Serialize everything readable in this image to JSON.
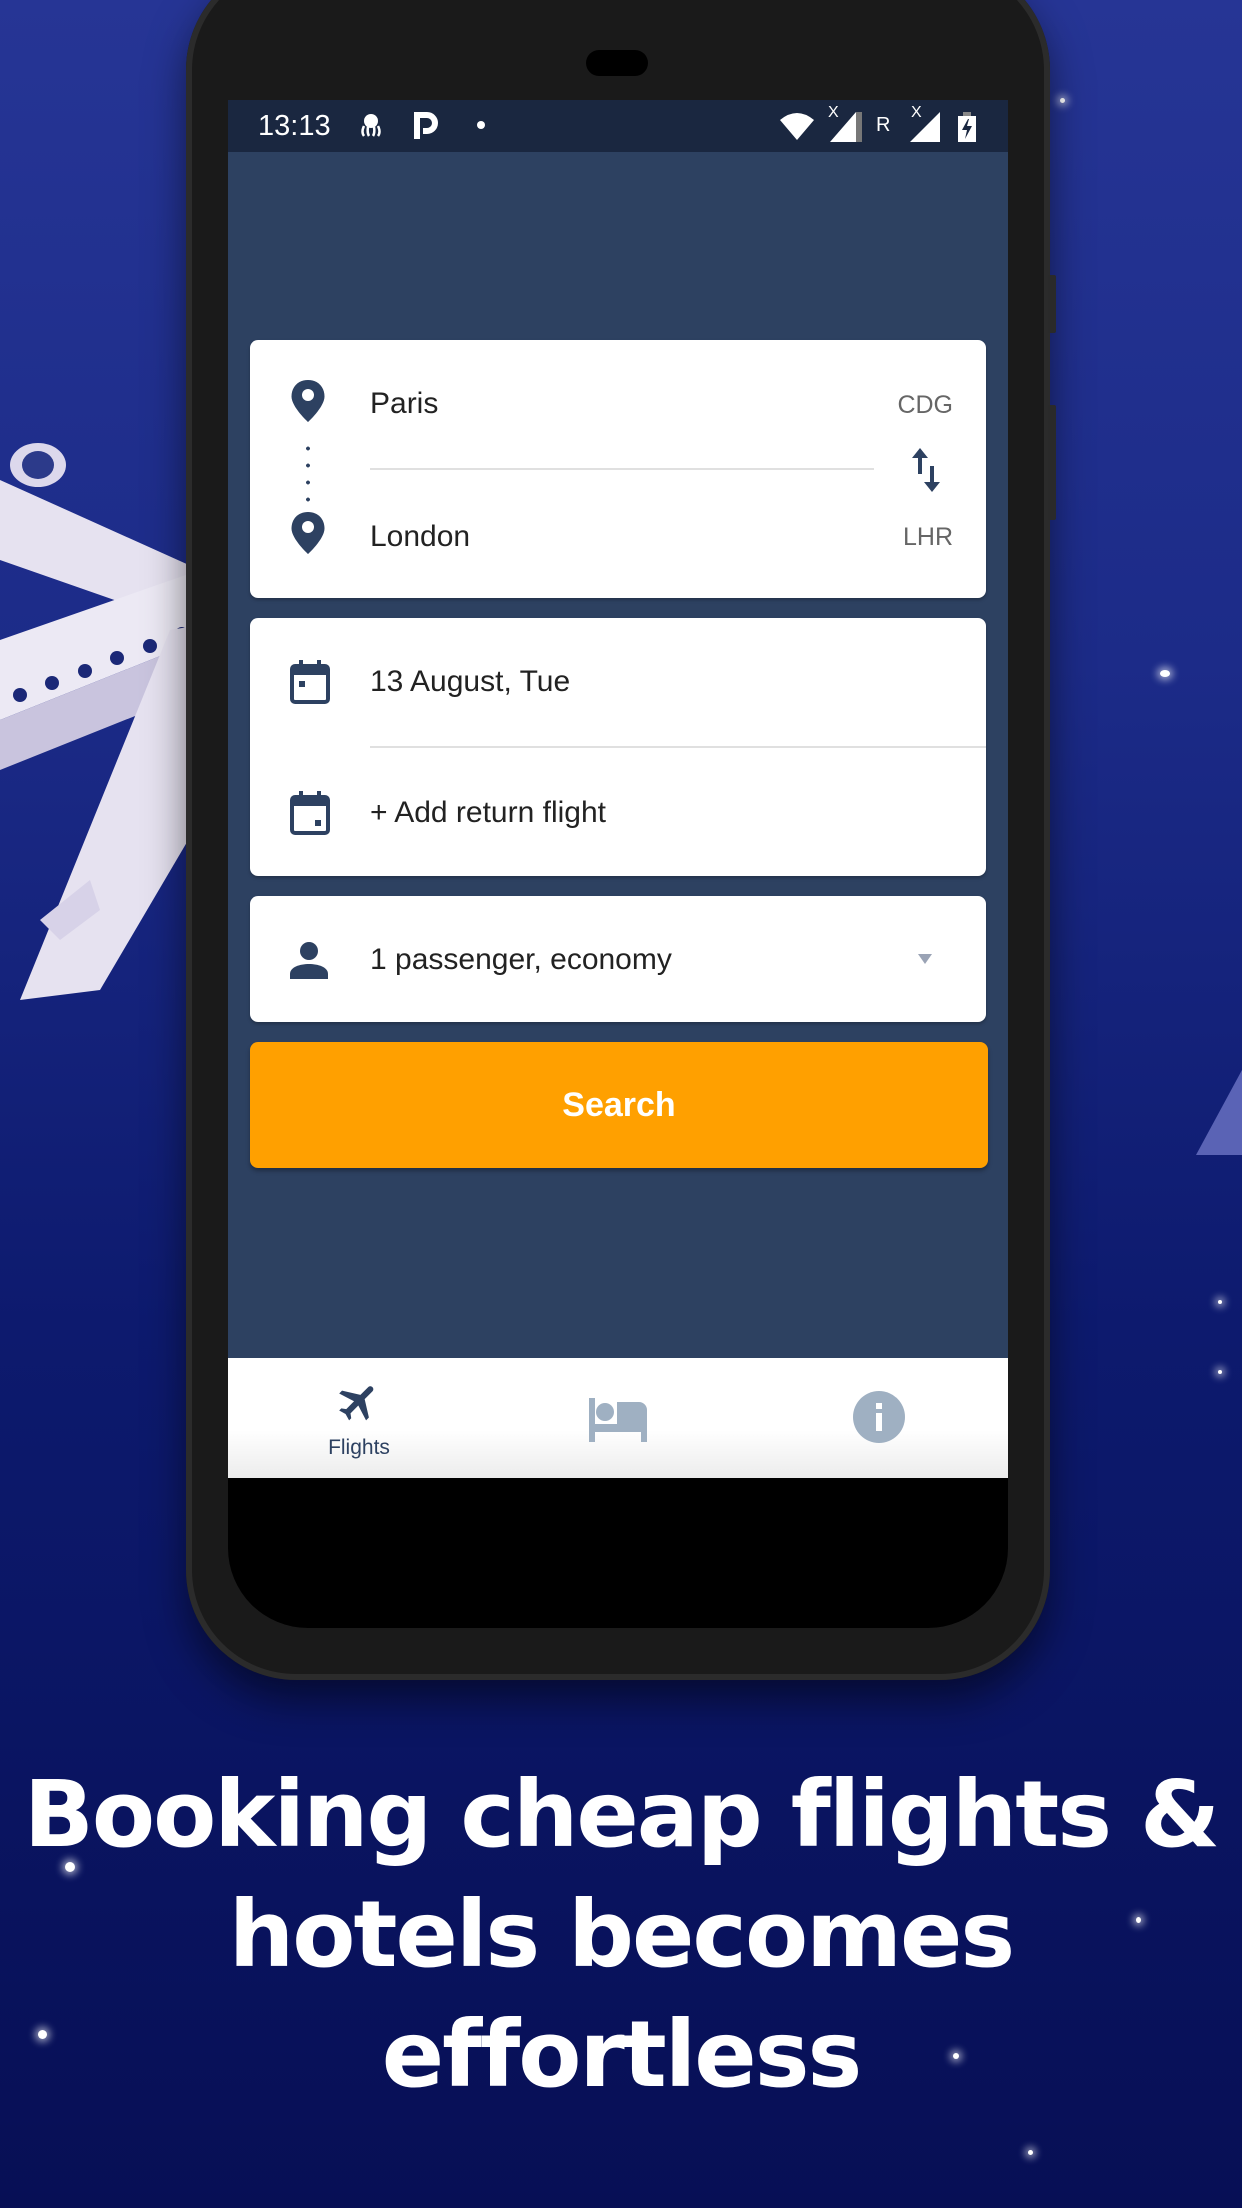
{
  "status_bar": {
    "time": "13:13",
    "left_icons": [
      "octopus-notification-icon",
      "parking-app-icon",
      "dot-icon"
    ],
    "right_icons": [
      "wifi-icon",
      "signal-icon",
      "roaming-indicator",
      "signal-icon",
      "battery-charging-icon"
    ],
    "roaming_label": "R",
    "no_data_mark": "X"
  },
  "route": {
    "origin": {
      "city": "Paris",
      "code": "CDG"
    },
    "destination": {
      "city": "London",
      "code": "LHR"
    },
    "swap_icon": "swap-vertical-icon"
  },
  "dates": {
    "departure": "13 August, Tue",
    "return_label": "+ Add return flight"
  },
  "passengers": {
    "value": "1 passenger, economy"
  },
  "search_button": {
    "label": "Search"
  },
  "bottom_nav": {
    "items": [
      {
        "label": "Flights",
        "icon": "airplane-icon",
        "active": true
      },
      {
        "label": "",
        "icon": "hotel-bed-icon",
        "active": false
      },
      {
        "label": "",
        "icon": "info-icon",
        "active": false
      }
    ]
  },
  "headline": {
    "lines": [
      "Booking cheap flights &",
      "hotels becomes",
      "effortless"
    ]
  },
  "colors": {
    "app_primary": "#2d4161",
    "accent": "#ffa000",
    "inactive_icon": "#9fb0c2"
  }
}
